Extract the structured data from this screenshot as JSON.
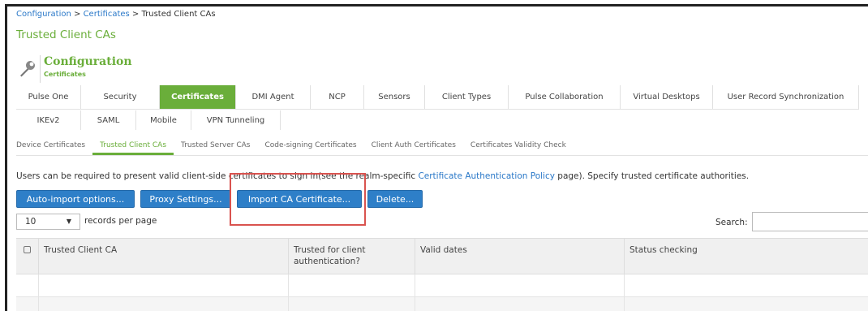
{
  "breadcrumb": {
    "item1": "Configuration",
    "sep": " > ",
    "item2": "Certificates",
    "current": "Trusted Client CAs"
  },
  "page_title": "Trusted Client CAs",
  "section": {
    "title": "Configuration",
    "subtitle": "Certificates",
    "icon": "wrench-icon"
  },
  "main_tabs_row1": [
    {
      "label": "Pulse One"
    },
    {
      "label": "Security"
    },
    {
      "label": "Certificates",
      "active": true
    },
    {
      "label": "DMI Agent"
    },
    {
      "label": "NCP"
    },
    {
      "label": "Sensors"
    },
    {
      "label": "Client Types"
    },
    {
      "label": "Pulse Collaboration"
    },
    {
      "label": "Virtual Desktops"
    },
    {
      "label": "User Record Synchronization"
    }
  ],
  "main_tabs_row2": [
    {
      "label": "IKEv2"
    },
    {
      "label": "SAML"
    },
    {
      "label": "Mobile"
    },
    {
      "label": "VPN Tunneling"
    }
  ],
  "sub_tabs": [
    {
      "label": "Device Certificates"
    },
    {
      "label": "Trusted Client CAs",
      "active": true
    },
    {
      "label": "Trusted Server CAs"
    },
    {
      "label": "Code-signing Certificates"
    },
    {
      "label": "Client Auth Certificates"
    },
    {
      "label": "Certificates Validity Check"
    }
  ],
  "description": {
    "before": "Users can be required to present valid client-side certificates to sign in(see the realm-specific ",
    "link": "Certificate Authentication Policy",
    "after": " page). Specify trusted certificate authorities."
  },
  "buttons": {
    "auto_import": "Auto-import options...",
    "proxy": "Proxy Settings...",
    "import_ca": "Import CA Certificate...",
    "delete": "Delete..."
  },
  "records": {
    "value": "10",
    "label": "records per page"
  },
  "search": {
    "label": "Search:",
    "value": ""
  },
  "table": {
    "columns": [
      "Trusted Client CA",
      "Trusted for client authentication?",
      "Valid dates",
      "Status checking"
    ]
  },
  "colors": {
    "accent_green": "#6aae3a",
    "button_blue": "#2e7fc8",
    "link_blue": "#2a78c8",
    "highlight_red": "#d9534f"
  }
}
